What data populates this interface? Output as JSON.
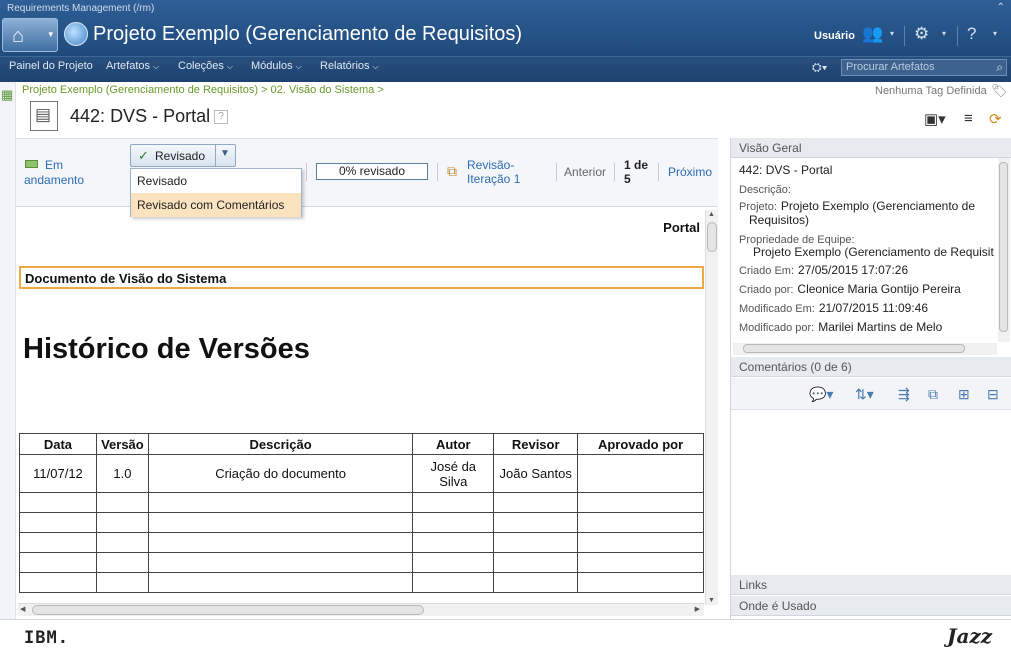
{
  "window": {
    "app_name": "Requirements Management (/rm)",
    "project_title": "Projeto Exemplo (Gerenciamento de Requisitos)",
    "user_label": "Usuário"
  },
  "nav": {
    "items": [
      "Painel do Projeto",
      "Artefatos",
      "Coleções",
      "Módulos",
      "Relatórios"
    ],
    "search_placeholder": "Procurar Artefatos"
  },
  "breadcrumb": "Projeto Exemplo (Gerenciamento de Requisitos) > 02. Visão do Sistema >",
  "tags_text": "Nenhuma Tag Definida",
  "artifact": {
    "id": "442:",
    "name": "DVS - Portal",
    "help": "?"
  },
  "review": {
    "status_line1": "Em",
    "status_line2": "andamento",
    "review_button": "Revisado",
    "options": [
      "Revisado",
      "Revisado com Comentários"
    ],
    "progress": "0% revisado",
    "iteration_line1": "Revisão-",
    "iteration_line2": "Iteração 1",
    "previous": "Anterior",
    "page_line1": "1 de",
    "page_line2": "5",
    "next": "Próximo"
  },
  "document": {
    "portal_label": "Portal",
    "vision_heading": "Documento de Visão do Sistema",
    "history_heading": "Histórico de Versões",
    "table_headers": [
      "Data",
      "Versão",
      "Descrição",
      "Autor",
      "Revisor",
      "Aprovado por"
    ],
    "rows": [
      [
        "11/07/12",
        "1.0",
        "Criação do documento",
        "José da Silva",
        "João Santos",
        ""
      ]
    ],
    "empty_rows": 5
  },
  "overview": {
    "header": "Visão Geral",
    "title": "442: DVS - Portal",
    "description_label": "Descrição:",
    "project_label": "Projeto:",
    "project_value": "Projeto Exemplo (Gerenciamento de",
    "project_value_2": "Requisitos)",
    "team_label": "Propriedade de Equipe:",
    "team_value": "Projeto Exemplo (Gerenciamento de Requisit",
    "created_label": "Criado Em:",
    "created_value": "27/05/2015 17:07:26",
    "created_by_label": "Criado por:",
    "created_by_value": "Cleonice Maria Gontijo Pereira",
    "modified_label": "Modificado Em:",
    "modified_value": "21/07/2015 11:09:46",
    "modified_by_label": "Modificado por:",
    "modified_by_value": "Marilei Martins de Melo"
  },
  "comments": {
    "header": "Comentários (0 de 6)"
  },
  "links": {
    "header": "Links"
  },
  "where_used": {
    "header": "Onde é Usado"
  },
  "footer": {
    "left_logo": "IBM.",
    "right_logo": "Jazz"
  }
}
